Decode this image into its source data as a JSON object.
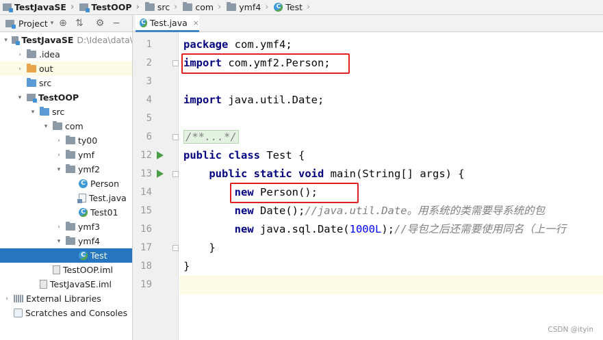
{
  "breadcrumb": [
    {
      "label": "TestJavaSE",
      "icon": "module-icon",
      "bold": true
    },
    {
      "label": "TestOOP",
      "icon": "module-icon",
      "bold": true
    },
    {
      "label": "src",
      "icon": "folder-icon"
    },
    {
      "label": "com",
      "icon": "folder-icon"
    },
    {
      "label": "ymf4",
      "icon": "folder-icon"
    },
    {
      "label": "Test",
      "icon": "class-icon"
    }
  ],
  "toolbar": {
    "project_label": "Project",
    "dropdown_icon": "chevron-down-icon",
    "target_icon": "locate-icon",
    "collapse_icon": "collapse-icon",
    "settings_icon": "gear-icon",
    "hide_icon": "minimize-icon"
  },
  "tab": {
    "label": "Test.java",
    "close": "×"
  },
  "tree": [
    {
      "label": "TestJavaSE",
      "path": "D:\\Idea\\data\\",
      "depth": 0,
      "arrow": "▾",
      "icon": "module",
      "bold": true
    },
    {
      "label": ".idea",
      "depth": 1,
      "arrow": "›",
      "icon": "folder"
    },
    {
      "label": "out",
      "depth": 1,
      "arrow": "›",
      "icon": "folder-orange",
      "highlight": true
    },
    {
      "label": "src",
      "depth": 1,
      "arrow": "",
      "icon": "folder-blue"
    },
    {
      "label": "TestOOP",
      "depth": 1,
      "arrow": "▾",
      "icon": "module",
      "bold": true
    },
    {
      "label": "src",
      "depth": 2,
      "arrow": "▾",
      "icon": "folder-blue"
    },
    {
      "label": "com",
      "depth": 3,
      "arrow": "▾",
      "icon": "folder"
    },
    {
      "label": "ty00",
      "depth": 4,
      "arrow": "›",
      "icon": "folder"
    },
    {
      "label": "ymf",
      "depth": 4,
      "arrow": "›",
      "icon": "folder"
    },
    {
      "label": "ymf2",
      "depth": 4,
      "arrow": "▾",
      "icon": "folder"
    },
    {
      "label": "Person",
      "depth": 5,
      "arrow": "",
      "icon": "class"
    },
    {
      "label": "Test.java",
      "depth": 5,
      "arrow": "",
      "icon": "java-file"
    },
    {
      "label": "Test01",
      "depth": 5,
      "arrow": "",
      "icon": "class-run"
    },
    {
      "label": "ymf3",
      "depth": 4,
      "arrow": "›",
      "icon": "folder"
    },
    {
      "label": "ymf4",
      "depth": 4,
      "arrow": "▾",
      "icon": "folder"
    },
    {
      "label": "Test",
      "depth": 5,
      "arrow": "",
      "icon": "class-run",
      "selected": true
    },
    {
      "label": "TestOOP.iml",
      "depth": 3,
      "arrow": "",
      "icon": "iml"
    },
    {
      "label": "TestJavaSE.iml",
      "depth": 2,
      "arrow": "",
      "icon": "iml"
    },
    {
      "label": "External Libraries",
      "depth": 0,
      "arrow": "›",
      "icon": "lib"
    },
    {
      "label": "Scratches and Consoles",
      "depth": 0,
      "arrow": "",
      "icon": "scratch"
    }
  ],
  "editor": {
    "line_numbers": [
      "1",
      "2",
      "3",
      "4",
      "5",
      "6",
      "12",
      "13",
      "14",
      "15",
      "16",
      "17",
      "18",
      "19"
    ],
    "lines": [
      {
        "segments": [
          {
            "t": "package",
            "c": "kw"
          },
          {
            "t": " com.ymf4;",
            "c": ""
          }
        ]
      },
      {
        "segments": [
          {
            "t": "import",
            "c": "kw"
          },
          {
            "t": " com.ymf2.Person;",
            "c": ""
          }
        ]
      },
      {
        "segments": []
      },
      {
        "segments": [
          {
            "t": "import",
            "c": "kw"
          },
          {
            "t": " java.util.Date;",
            "c": ""
          }
        ]
      },
      {
        "segments": []
      },
      {
        "segments": [
          {
            "t": "/**...*/",
            "c": "fold-text"
          }
        ]
      },
      {
        "segments": [
          {
            "t": "public",
            "c": "kw"
          },
          {
            "t": " ",
            "c": ""
          },
          {
            "t": "class",
            "c": "kw"
          },
          {
            "t": " Test {",
            "c": ""
          }
        ]
      },
      {
        "segments": [
          {
            "t": "    ",
            "c": ""
          },
          {
            "t": "public",
            "c": "kw"
          },
          {
            "t": " ",
            "c": ""
          },
          {
            "t": "static",
            "c": "kw"
          },
          {
            "t": " ",
            "c": ""
          },
          {
            "t": "void",
            "c": "kw"
          },
          {
            "t": " main(String[] args) {",
            "c": ""
          }
        ]
      },
      {
        "segments": [
          {
            "t": "        ",
            "c": ""
          },
          {
            "t": "new",
            "c": "kw"
          },
          {
            "t": " Person();",
            "c": ""
          }
        ]
      },
      {
        "segments": [
          {
            "t": "        ",
            "c": ""
          },
          {
            "t": "new",
            "c": "kw"
          },
          {
            "t": " Date();",
            "c": ""
          },
          {
            "t": "//java.util.Date。用系统的类需要导系统的包",
            "c": "cm"
          }
        ]
      },
      {
        "segments": [
          {
            "t": "        ",
            "c": ""
          },
          {
            "t": "new",
            "c": "kw"
          },
          {
            "t": " java.sql.Date(",
            "c": ""
          },
          {
            "t": "1000L",
            "c": "num"
          },
          {
            "t": ");",
            "c": ""
          },
          {
            "t": "//导包之后还需要使用同名（上一行",
            "c": "cm"
          }
        ]
      },
      {
        "segments": [
          {
            "t": "    }",
            "c": ""
          }
        ]
      },
      {
        "segments": [
          {
            "t": "}",
            "c": ""
          }
        ]
      },
      {
        "segments": []
      }
    ],
    "caret_line_index": 13,
    "run_marker_lines": [
      6,
      7
    ],
    "fold_marker_lines": [
      1,
      5,
      7,
      11
    ]
  },
  "annotations": {
    "color": "#e02020",
    "boxed_lines": [
      1,
      8
    ]
  },
  "watermark": "CSDN @ityin"
}
